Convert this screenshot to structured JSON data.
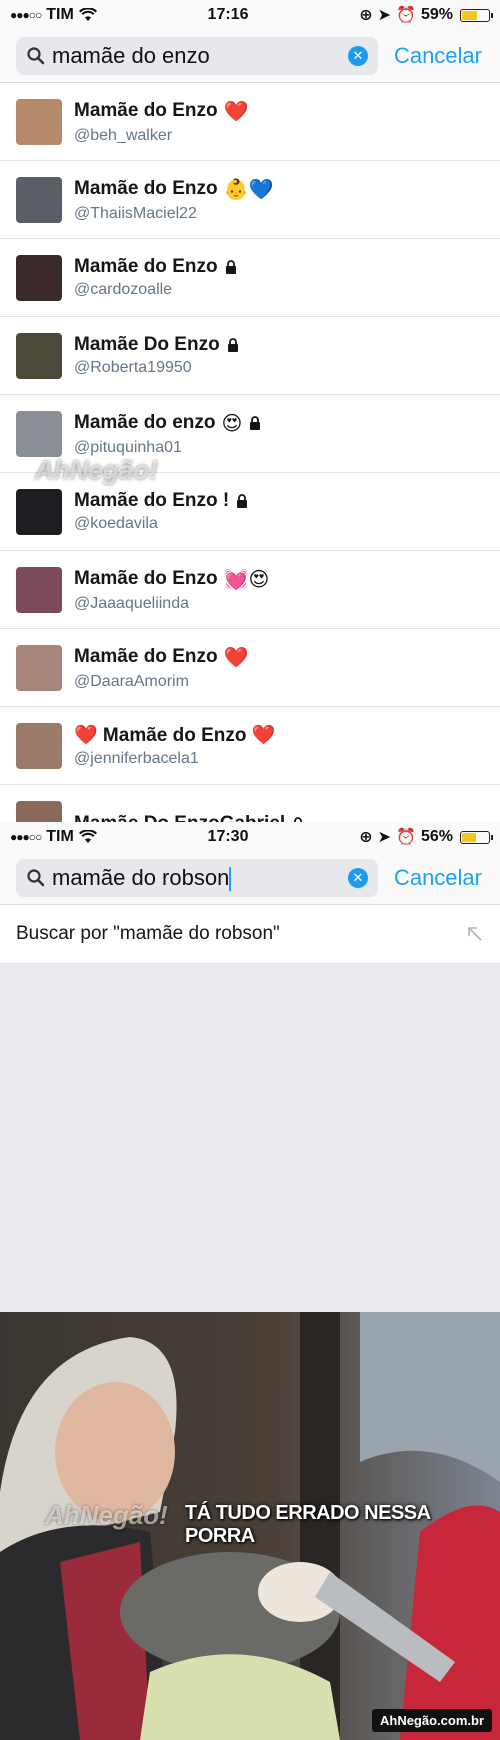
{
  "screen1": {
    "status": {
      "carrier": "TIM",
      "time": "17:16",
      "battery": "59%",
      "battery_level": 0.59
    },
    "search": {
      "query": "mamãe do enzo",
      "cancel_label": "Cancelar"
    },
    "results": [
      {
        "name": "Mamãe do Enzo",
        "handle": "@beh_walker",
        "badges": "❤️",
        "locked": false,
        "avatar_color": "#b58a6a"
      },
      {
        "name": "Mamãe do Enzo",
        "handle": "@ThaiisMaciel22",
        "badges": "👶💙",
        "locked": false,
        "avatar_color": "#5a5f66"
      },
      {
        "name": "Mamãe do Enzo",
        "handle": "@cardozoalle",
        "badges": "",
        "locked": true,
        "avatar_color": "#3a2a2a"
      },
      {
        "name": "Mamãe Do Enzo",
        "handle": "@Roberta19950",
        "badges": "",
        "locked": true,
        "avatar_color": "#4b4a3a"
      },
      {
        "name": "Mamãe do enzo",
        "handle": "@pituquinha01",
        "badges": "😍",
        "locked": true,
        "avatar_color": "#8a8f96"
      },
      {
        "name": "Mamãe do Enzo !",
        "handle": "@koedavila",
        "badges": "",
        "locked": true,
        "avatar_color": "#1e1e22"
      },
      {
        "name": "Mamãe do Enzo",
        "handle": "@Jaaaqueliinda",
        "badges": "💓😍",
        "locked": false,
        "avatar_color": "#7a4a5a"
      },
      {
        "name": "Mamãe do Enzo",
        "handle": "@DaaraAmorim",
        "badges": "❤️",
        "locked": false,
        "avatar_color": "#a8857a"
      },
      {
        "name": "❤️ Mamãe do Enzo ❤️",
        "handle": "@jenniferbacela1",
        "badges": "",
        "locked": false,
        "avatar_color": "#9a7b6a"
      },
      {
        "name": "Mamãe Do EnzoGabriel",
        "handle": "",
        "badges": "",
        "locked": true,
        "avatar_color": "#8a6a5a"
      }
    ]
  },
  "screen2": {
    "status": {
      "carrier": "TIM",
      "time": "17:30",
      "battery": "56%",
      "battery_level": 0.56
    },
    "search": {
      "query": "mamãe do robson",
      "cancel_label": "Cancelar"
    },
    "suggestion": "Buscar por \"mamãe do robson\""
  },
  "meme": {
    "caption": "TÁ TUDO ERRADO NESSA PORRA",
    "watermark_badge": "AhNegão.com.br"
  },
  "watermarks": [
    "AhNegão!",
    "AhNegão!"
  ]
}
